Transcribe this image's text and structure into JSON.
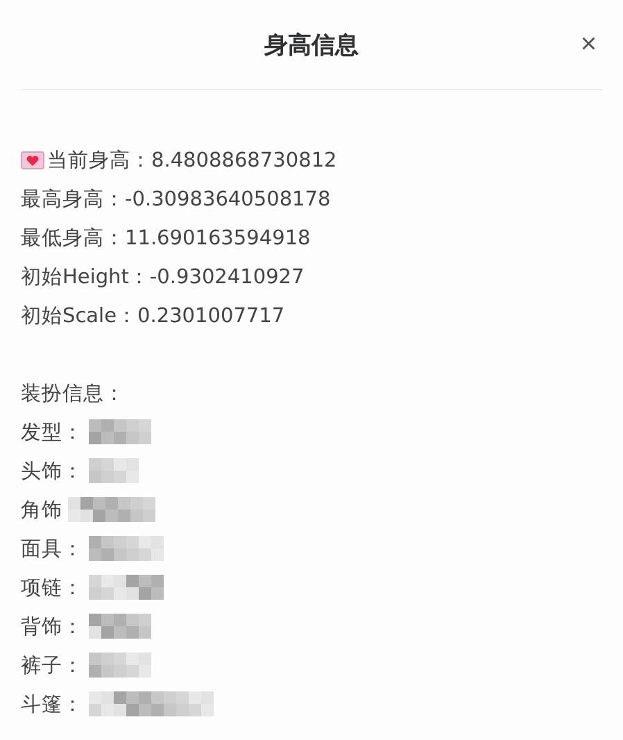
{
  "dialog": {
    "title": "身高信息",
    "close": "×"
  },
  "stats": [
    {
      "text": "当前身高：8.4808868730812",
      "icon": true
    },
    {
      "text": "最高身高：-0.30983640508178",
      "icon": false
    },
    {
      "text": "最低身高：11.690163594918",
      "icon": false
    },
    {
      "text": "初始Height：-0.9302410927",
      "icon": false
    },
    {
      "text": "初始Scale：0.2301007717",
      "icon": false
    }
  ],
  "outfit": {
    "heading": "装扮信息：",
    "items": [
      {
        "label": "发型："
      },
      {
        "label": "头饰："
      },
      {
        "label": "角饰"
      },
      {
        "label": "面具："
      },
      {
        "label": "项链："
      },
      {
        "label": "背饰："
      },
      {
        "label": "裤子："
      },
      {
        "label": "斗篷："
      }
    ]
  }
}
